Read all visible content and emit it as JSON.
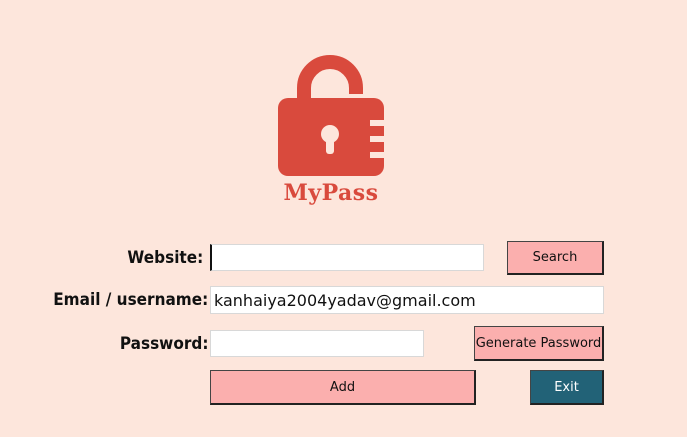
{
  "app": {
    "logo_text": "MyPass",
    "accent_color": "#d94a3d"
  },
  "form": {
    "website_label": "Website:",
    "website_value": "",
    "email_label": "Email / username:",
    "email_value": "kanhaiya2004yadav@gmail.com",
    "password_label": "Password:",
    "password_value": ""
  },
  "buttons": {
    "search": "Search",
    "generate": "Generate Password",
    "add": "Add",
    "exit": "Exit"
  },
  "colors": {
    "background": "#fde6dc",
    "button": "#fbafae",
    "exit_button": "#226277"
  }
}
